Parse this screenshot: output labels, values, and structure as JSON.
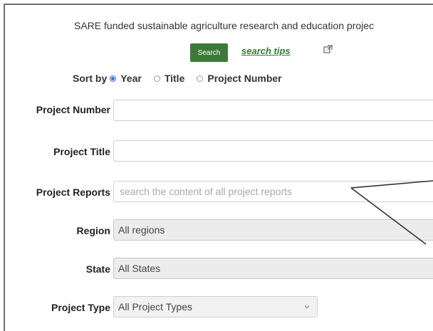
{
  "intro_text": "SARE funded sustainable agriculture research and education projec",
  "search_button": "Search",
  "search_tips": "search tips",
  "sort": {
    "label": "Sort by",
    "options": [
      {
        "label": "Year",
        "selected": true
      },
      {
        "label": "Title",
        "selected": false
      },
      {
        "label": "Project Number",
        "selected": false
      }
    ]
  },
  "fields": {
    "project_number": {
      "label": "Project Number",
      "value": ""
    },
    "project_title": {
      "label": "Project Title",
      "value": ""
    },
    "project_reports": {
      "label": "Project Reports",
      "placeholder": "search the content of all project reports"
    },
    "region": {
      "label": "Region",
      "value": "All regions"
    },
    "state": {
      "label": "State",
      "value": "All States"
    },
    "project_type": {
      "label": "Project Type",
      "value": "All Project Types"
    }
  },
  "colors": {
    "button_green": "#3c7a3a",
    "link_green": "#2e7d32",
    "radio_selected": "#3a6fd8"
  },
  "icons": {
    "search_tips": "external-link-icon",
    "project_type": "chevron-down-icon"
  }
}
